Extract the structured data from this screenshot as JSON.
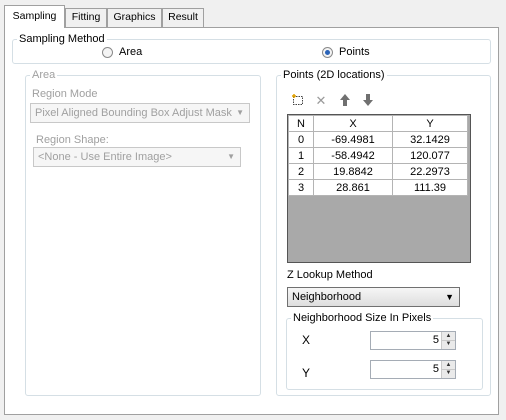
{
  "tabs": [
    {
      "label": "Sampling",
      "active": true
    },
    {
      "label": "Fitting"
    },
    {
      "label": "Graphics"
    },
    {
      "label": "Result"
    }
  ],
  "sampling_method": {
    "legend": "Sampling Method",
    "options": [
      {
        "label": "Area",
        "selected": false
      },
      {
        "label": "Points",
        "selected": true
      }
    ]
  },
  "area": {
    "legend": "Area",
    "region_mode_label": "Region Mode",
    "region_mode_value": "Pixel Aligned Bounding Box Adjust Mask",
    "region_shape_label": "Region Shape:",
    "region_shape_value": "<None - Use Entire Image>"
  },
  "points": {
    "legend": "Points (2D locations)",
    "toolbar_icons": [
      "add-point-icon",
      "delete-icon",
      "move-up-icon",
      "move-down-icon"
    ],
    "columns": [
      "N",
      "X",
      "Y"
    ],
    "rows": [
      [
        "0",
        "-69.4981",
        "32.1429"
      ],
      [
        "1",
        "-58.4942",
        "120.077"
      ],
      [
        "2",
        "19.8842",
        "22.2973"
      ],
      [
        "3",
        "28.861",
        "111.39"
      ]
    ]
  },
  "z_lookup": {
    "label": "Z Lookup Method",
    "value": "Neighborhood"
  },
  "neighborhood": {
    "legend": "Neighborhood Size In Pixels",
    "x_label": "X",
    "x_value": "5",
    "y_label": "Y",
    "y_value": "5"
  },
  "colors": {
    "radio_selected": "#2a63b8",
    "grid_empty_area": "#a9a9a9",
    "disabled_text": "#a0a0a0"
  }
}
